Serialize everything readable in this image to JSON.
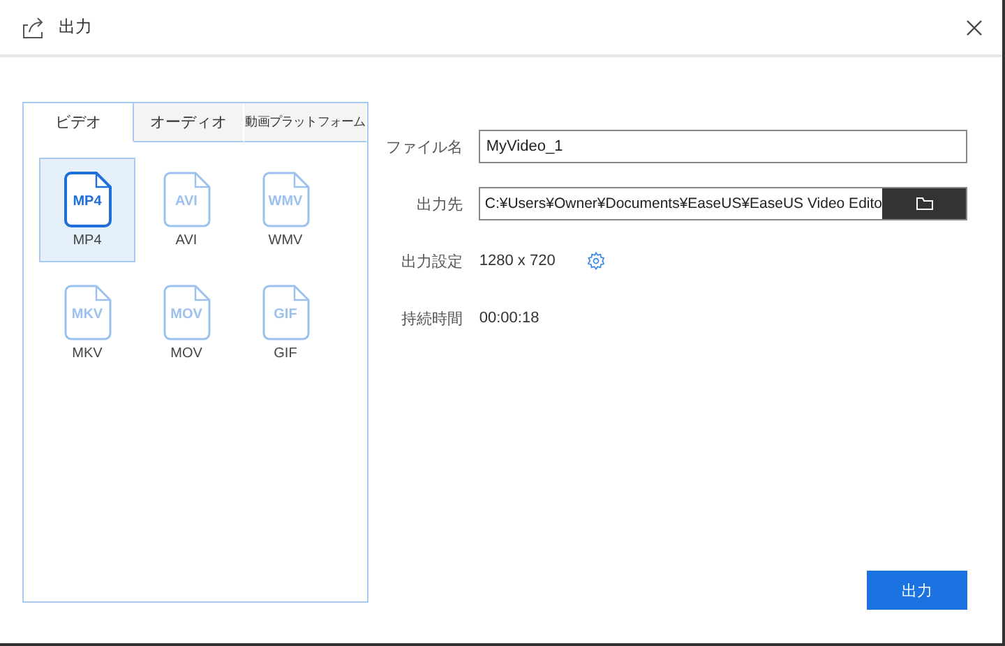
{
  "window": {
    "title": "出力"
  },
  "tabs": [
    {
      "label": "ビデオ",
      "selected": true
    },
    {
      "label": "オーディオ",
      "selected": false
    },
    {
      "label": "動画プラットフォーム",
      "selected": false
    }
  ],
  "formats": [
    {
      "badge": "MP4",
      "label": "MP4",
      "selected": true
    },
    {
      "badge": "AVI",
      "label": "AVI",
      "selected": false
    },
    {
      "badge": "WMV",
      "label": "WMV",
      "selected": false
    },
    {
      "badge": "MKV",
      "label": "MKV",
      "selected": false
    },
    {
      "badge": "MOV",
      "label": "MOV",
      "selected": false
    },
    {
      "badge": "GIF",
      "label": "GIF",
      "selected": false
    }
  ],
  "fields": [
    {
      "kind": "input",
      "label": "ファイル名",
      "value": "MyVideo_1"
    },
    {
      "kind": "folder",
      "label": "出力先",
      "value": "C:¥Users¥Owner¥Documents¥EaseUS¥EaseUS Video Edito"
    },
    {
      "kind": "setting",
      "label": "出力設定",
      "value": "1280 x 720"
    },
    {
      "kind": "text",
      "label": "持続時間",
      "value": "00:00:18"
    }
  ],
  "export_button": "出力"
}
